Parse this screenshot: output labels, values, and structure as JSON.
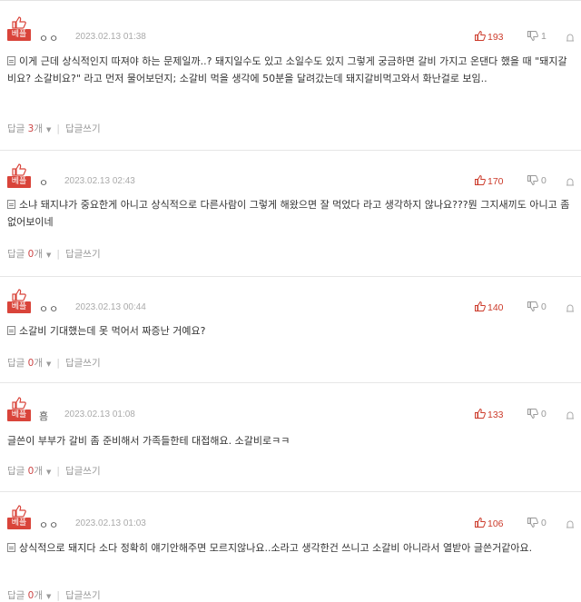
{
  "best_label": "베플",
  "reply_label_prefix": "답글",
  "reply_count_suffix": "개",
  "write_reply_label": "답글쓰기",
  "colors": {
    "best_badge": "#d9443a",
    "like": "#cc3b2b",
    "meta": "#aaaaaa"
  },
  "comments": [
    {
      "author": "ㅇㅇ",
      "date": "2023.02.13 01:38",
      "likes": "193",
      "dislikes": "1",
      "text": "이게 근데 상식적인지 따져야 하는 문제일까..? 돼지일수도 있고 소일수도 있지 그렇게 궁금하면 갈비 가지고 온댄다 했을 때 \"돼지갈비요? 소갈비요?\" 라고 먼저 물어보던지; 소갈비 먹을 생각에 50분을 달려갔는데 돼지갈비먹고와서 화난걸로 보임..",
      "reply_count": "3"
    },
    {
      "author": "ㅇ",
      "date": "2023.02.13 02:43",
      "likes": "170",
      "dislikes": "0",
      "text": "소냐 돼지냐가 중요한게 아니고 상식적으로 다른사람이 그렇게 해왔으면 잘 먹었다 라고 생각하지 않나요???뭔 그지새끼도 아니고 좀 없어보이네",
      "reply_count": "0"
    },
    {
      "author": "ㅇㅇ",
      "date": "2023.02.13 00:44",
      "likes": "140",
      "dislikes": "0",
      "text": "소갈비 기대했는데 못 먹어서 짜증난 거예요?",
      "reply_count": "0"
    },
    {
      "author": "흠",
      "date": "2023.02.13 01:08",
      "likes": "133",
      "dislikes": "0",
      "text": "글쓴이 부부가 갈비 좀 준비해서 가족들한테 대접해요. 소갈비로ㅋㅋ",
      "reply_count": "0"
    },
    {
      "author": "ㅇㅇ",
      "date": "2023.02.13 01:03",
      "likes": "106",
      "dislikes": "0",
      "text": "상식적으로 돼지다 소다 정확히 얘기안해주면 모르지않나요..소라고 생각한건 쓰니고 소갈비 아니라서 열받아 글쓴거같아요.",
      "reply_count": "0"
    }
  ]
}
